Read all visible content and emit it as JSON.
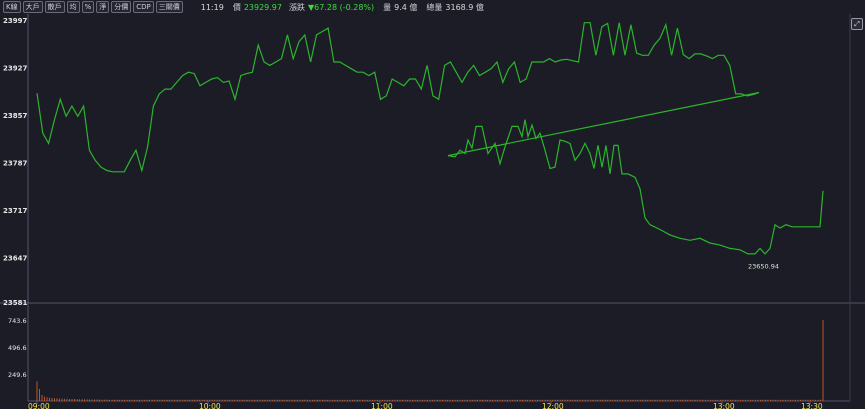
{
  "toolbar": {
    "tabs": [
      "K線",
      "大戶",
      "散戶",
      "均",
      "%",
      "淨",
      "分價",
      "CDP",
      "三關價"
    ],
    "time": "11:19",
    "price_label": "價",
    "price": "23929.97",
    "change_label": "漲跌",
    "change": "▼67.28 (-0.28%)",
    "volume_label": "量",
    "volume": "9.4 億",
    "total_label": "總量",
    "total": "3168.9 億"
  },
  "expand_icon": "expand-icon",
  "annotation": "23650.94",
  "colors": {
    "price_line": "#2bb52b",
    "volume_bar": "#e0662a",
    "accent_up": "#3ddc3d",
    "time_axis": "#f0e35a"
  },
  "chart_data": {
    "type": "line",
    "price": {
      "ylim": [
        23581,
        23997
      ],
      "yticks": [
        23997,
        23927,
        23857,
        23787,
        23717,
        23647,
        23581
      ],
      "xlim": [
        0,
        270
      ],
      "points": [
        [
          0,
          23889
        ],
        [
          2,
          23830
        ],
        [
          4,
          23815
        ],
        [
          6,
          23850
        ],
        [
          8,
          23880
        ],
        [
          10,
          23855
        ],
        [
          12,
          23870
        ],
        [
          14,
          23855
        ],
        [
          16,
          23870
        ],
        [
          18,
          23805
        ],
        [
          20,
          23790
        ],
        [
          22,
          23780
        ],
        [
          24,
          23775
        ],
        [
          26,
          23773
        ],
        [
          28,
          23773
        ],
        [
          30,
          23773
        ],
        [
          32,
          23790
        ],
        [
          34,
          23805
        ],
        [
          36,
          23775
        ],
        [
          38,
          23810
        ],
        [
          40,
          23870
        ],
        [
          42,
          23888
        ],
        [
          44,
          23895
        ],
        [
          46,
          23895
        ],
        [
          48,
          23905
        ],
        [
          50,
          23915
        ],
        [
          52,
          23920
        ],
        [
          54,
          23918
        ],
        [
          56,
          23900
        ],
        [
          58,
          23905
        ],
        [
          60,
          23910
        ],
        [
          62,
          23912
        ],
        [
          64,
          23905
        ],
        [
          66,
          23907
        ],
        [
          68,
          23880
        ],
        [
          70,
          23915
        ],
        [
          72,
          23918
        ],
        [
          74,
          23920
        ],
        [
          76,
          23960
        ],
        [
          78,
          23935
        ],
        [
          80,
          23930
        ],
        [
          82,
          23935
        ],
        [
          84,
          23940
        ],
        [
          86,
          23975
        ],
        [
          88,
          23940
        ],
        [
          90,
          23965
        ],
        [
          92,
          23975
        ],
        [
          94,
          23935
        ],
        [
          96,
          23975
        ],
        [
          98,
          23980
        ],
        [
          100,
          23985
        ],
        [
          102,
          23935
        ],
        [
          104,
          23935
        ],
        [
          106,
          23930
        ],
        [
          108,
          23925
        ],
        [
          110,
          23920
        ],
        [
          112,
          23920
        ],
        [
          114,
          23915
        ],
        [
          116,
          23920
        ],
        [
          118,
          23880
        ],
        [
          120,
          23885
        ],
        [
          122,
          23910
        ],
        [
          124,
          23905
        ],
        [
          126,
          23900
        ],
        [
          128,
          23910
        ],
        [
          130,
          23910
        ],
        [
          132,
          23895
        ],
        [
          134,
          23930
        ],
        [
          136,
          23885
        ],
        [
          138,
          23880
        ],
        [
          140,
          23930
        ],
        [
          142,
          23935
        ],
        [
          144,
          23920
        ],
        [
          146,
          23905
        ],
        [
          148,
          23920
        ],
        [
          150,
          23930
        ],
        [
          152,
          23915
        ],
        [
          154,
          23920
        ],
        [
          156,
          23925
        ],
        [
          158,
          23935
        ],
        [
          160,
          23905
        ],
        [
          162,
          23925
        ],
        [
          164,
          23935
        ],
        [
          166,
          23905
        ],
        [
          168,
          23910
        ],
        [
          170,
          23935
        ],
        [
          172,
          23935
        ],
        [
          174,
          23935
        ],
        [
          176,
          23940
        ],
        [
          178,
          23935
        ],
        [
          180,
          23938
        ],
        [
          182,
          23939
        ],
        [
          184,
          23937
        ],
        [
          186,
          23935
        ],
        [
          188,
          23993
        ],
        [
          190,
          23993
        ],
        [
          192,
          23945
        ],
        [
          194,
          23987
        ],
        [
          196,
          23992
        ],
        [
          198,
          23945
        ],
        [
          200,
          23993
        ],
        [
          202,
          23945
        ],
        [
          204,
          23990
        ],
        [
          206,
          23948
        ],
        [
          208,
          23945
        ],
        [
          210,
          23945
        ],
        [
          212,
          23960
        ],
        [
          214,
          23970
        ],
        [
          216,
          23990
        ],
        [
          218,
          23945
        ],
        [
          220,
          23985
        ],
        [
          222,
          23946
        ],
        [
          224,
          23940
        ],
        [
          226,
          23947
        ],
        [
          228,
          23947
        ],
        [
          230,
          23944
        ],
        [
          232,
          23940
        ],
        [
          234,
          23945
        ],
        [
          236,
          23945
        ],
        [
          238,
          23930
        ],
        [
          240,
          23888
        ],
        [
          242,
          23888
        ],
        [
          244,
          23885
        ],
        [
          246,
          23887
        ],
        [
          248,
          23890
        ]
      ],
      "annotation_value": 23650.94
    },
    "volume": {
      "ylim": [
        0,
        800
      ],
      "yticks": [
        743.6,
        496.6,
        249.6
      ],
      "bars": [
        180,
        110,
        55,
        40,
        35,
        30,
        28,
        25,
        25,
        22,
        22,
        20,
        20,
        18,
        18,
        18,
        18,
        16,
        16,
        16,
        15,
        15,
        15,
        14,
        14,
        14,
        13,
        13,
        13,
        12,
        12,
        12,
        12,
        12,
        12,
        12,
        12,
        12,
        12,
        12,
        12,
        12,
        12,
        12,
        12,
        12,
        12,
        12,
        12,
        12,
        12,
        12,
        12,
        12,
        12,
        12,
        12,
        12,
        12,
        12,
        12,
        12,
        12,
        12,
        12,
        12,
        12,
        12,
        12,
        12,
        12,
        12,
        12,
        12,
        12,
        12,
        12,
        12,
        12,
        12,
        12,
        12,
        12,
        12,
        12,
        12,
        12,
        12,
        12,
        12,
        12,
        12,
        12,
        12,
        12,
        12,
        12,
        12,
        12,
        12,
        12,
        12,
        12,
        12,
        12,
        12,
        12,
        12,
        12,
        12,
        12,
        12,
        12,
        12,
        12,
        12,
        12,
        12,
        12,
        12,
        12,
        12,
        12,
        12,
        12,
        12,
        12,
        12,
        12,
        12,
        12,
        12,
        12,
        12,
        12,
        12,
        12,
        12,
        12,
        12,
        12,
        12,
        12,
        12,
        12,
        12,
        12,
        12,
        12,
        12,
        12,
        12,
        12,
        12,
        12,
        12,
        12,
        12,
        12,
        12,
        12,
        12,
        12,
        12,
        12,
        12,
        12,
        12,
        12,
        12,
        12,
        12,
        12,
        12,
        12,
        12,
        12,
        12,
        12,
        12,
        12,
        12,
        12,
        12,
        12,
        12,
        12,
        12,
        12,
        12,
        12,
        12,
        12,
        12,
        12,
        12,
        12,
        12,
        12,
        12,
        12,
        12,
        12,
        12,
        12,
        12,
        12,
        12,
        12,
        12,
        12,
        12,
        12,
        12,
        12,
        12,
        12,
        12,
        12,
        12,
        12,
        12,
        12,
        12,
        12,
        12,
        12,
        12,
        12,
        12,
        12,
        12,
        12,
        12,
        12,
        12,
        12,
        12,
        12,
        12,
        12,
        12,
        12,
        12,
        12,
        12,
        12,
        12,
        12,
        12,
        12,
        12,
        12,
        12,
        12,
        12,
        12,
        12,
        12,
        12,
        12,
        12,
        12,
        12,
        12,
        12,
        12,
        12,
        12,
        12,
        12,
        12,
        12,
        12,
        12,
        12,
        12,
        12,
        12,
        12,
        12,
        12,
        12,
        12,
        12,
        12,
        12,
        12,
        12,
        12,
        12,
        12,
        12,
        12,
        12,
        12,
        12,
        12,
        12,
        12,
        12,
        12,
        12,
        12,
        12,
        12,
        12,
        12,
        12,
        12,
        12,
        12,
        12,
        12,
        743.6
      ]
    },
    "xticks": [
      "09:00",
      "10:00",
      "11:00",
      "12:00",
      "13:00",
      "13:30"
    ]
  }
}
